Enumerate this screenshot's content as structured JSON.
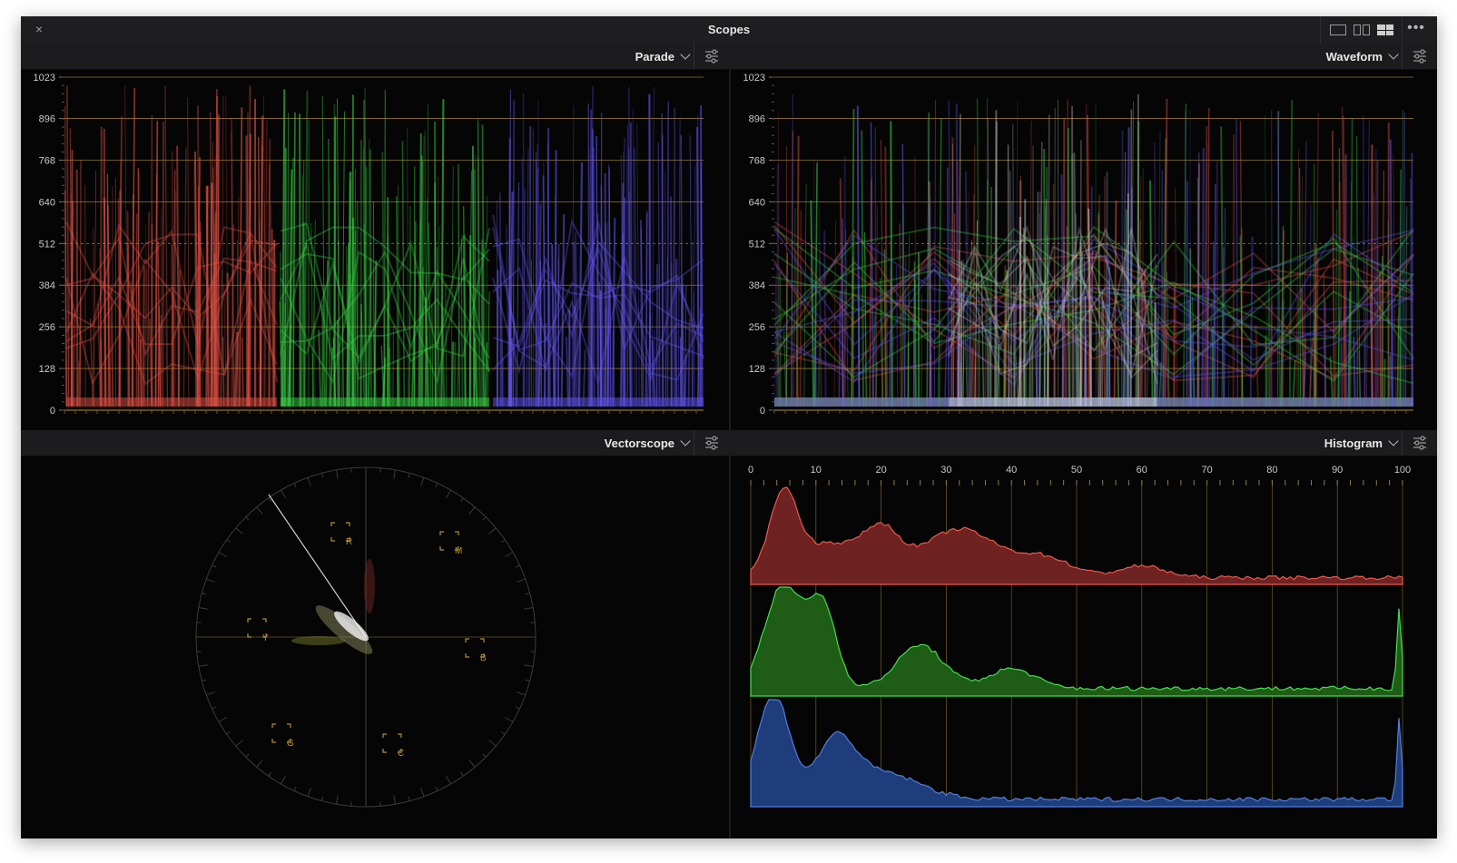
{
  "window": {
    "title": "Scopes",
    "close_label": "×",
    "more_label": "•••"
  },
  "layout_buttons": [
    "single-view-icon",
    "dual-view-icon",
    "quad-view-icon"
  ],
  "panels": {
    "parade": {
      "title": "Parade"
    },
    "waveform": {
      "title": "Waveform"
    },
    "vectorscope": {
      "title": "Vectorscope"
    },
    "histogram": {
      "title": "Histogram"
    }
  },
  "colors": {
    "red": "#f0574a",
    "green": "#3fe04a",
    "blue": "#6a5cff",
    "grid": "#b58f34",
    "hist_red": "#6e2222",
    "hist_green": "#1f5c16",
    "hist_blue": "#1f3d7a"
  },
  "waveform_scale": {
    "labels": [
      "1023",
      "896",
      "768",
      "640",
      "512",
      "384",
      "256",
      "128",
      "0"
    ],
    "values": [
      1023,
      896,
      768,
      640,
      512,
      384,
      256,
      128,
      0
    ]
  },
  "vectorscope_targets": [
    "R",
    "M",
    "Y",
    "B",
    "G",
    "C"
  ],
  "histogram_scale": {
    "labels": [
      "0",
      "10",
      "20",
      "30",
      "40",
      "50",
      "60",
      "70",
      "80",
      "90",
      "100"
    ],
    "values": [
      0,
      10,
      20,
      30,
      40,
      50,
      60,
      70,
      80,
      90,
      100
    ]
  }
}
